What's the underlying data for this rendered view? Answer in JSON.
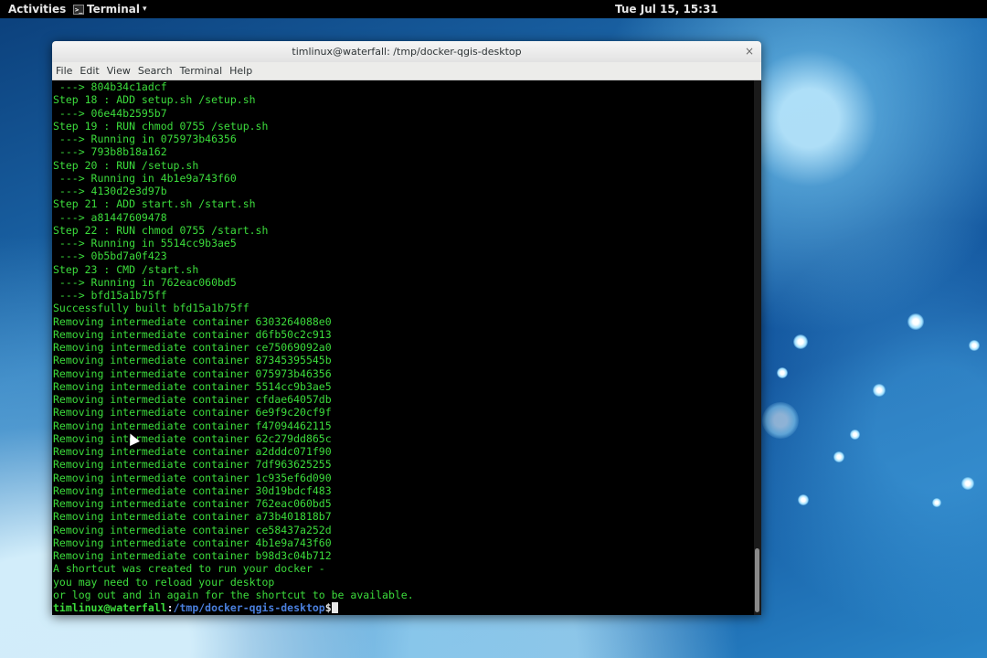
{
  "topbar": {
    "activities": "Activities",
    "app_name": "Terminal",
    "app_caret": "▾",
    "clock": "Tue Jul 15, 15:31"
  },
  "window": {
    "title": "timlinux@waterfall: /tmp/docker-qgis-desktop",
    "close_glyph": "×",
    "menu": [
      "File",
      "Edit",
      "View",
      "Search",
      "Terminal",
      "Help"
    ]
  },
  "terminal": {
    "lines": [
      " ---> 804b34c1adcf",
      "Step 18 : ADD setup.sh /setup.sh",
      " ---> 06e44b2595b7",
      "Step 19 : RUN chmod 0755 /setup.sh",
      " ---> Running in 075973b46356",
      " ---> 793b8b18a162",
      "Step 20 : RUN /setup.sh",
      " ---> Running in 4b1e9a743f60",
      " ---> 4130d2e3d97b",
      "Step 21 : ADD start.sh /start.sh",
      " ---> a81447609478",
      "Step 22 : RUN chmod 0755 /start.sh",
      " ---> Running in 5514cc9b3ae5",
      " ---> 0b5bd7a0f423",
      "Step 23 : CMD /start.sh",
      " ---> Running in 762eac060bd5",
      " ---> bfd15a1b75ff",
      "Successfully built bfd15a1b75ff",
      "Removing intermediate container 6303264088e0",
      "Removing intermediate container d6fb50c2c913",
      "Removing intermediate container ce75069092a0",
      "Removing intermediate container 87345395545b",
      "Removing intermediate container 075973b46356",
      "Removing intermediate container 5514cc9b3ae5",
      "Removing intermediate container cfdae64057db",
      "Removing intermediate container 6e9f9c20cf9f",
      "Removing intermediate container f47094462115",
      "Removing intermediate container 62c279dd865c",
      "Removing intermediate container a2dddc071f90",
      "Removing intermediate container 7df963625255",
      "Removing intermediate container 1c935ef6d090",
      "Removing intermediate container 30d19bdcf483",
      "Removing intermediate container 762eac060bd5",
      "Removing intermediate container a73b401818b7",
      "Removing intermediate container ce58437a252d",
      "Removing intermediate container 4b1e9a743f60",
      "Removing intermediate container b98d3c04b712",
      "A shortcut was created to run your docker -",
      "you may need to reload your desktop",
      "or log out and in again for the shortcut to be available."
    ],
    "prompt": {
      "user_host": "timlinux@waterfall",
      "separator": ":",
      "path": "/tmp/docker-qgis-desktop",
      "symbol": "$"
    }
  },
  "colors": {
    "terminal_text": "#3cdc3c",
    "prompt_path": "#4a7fdd",
    "terminal_bg": "#000000"
  },
  "icons": {
    "app_icon": "terminal-icon",
    "close": "close-icon"
  }
}
